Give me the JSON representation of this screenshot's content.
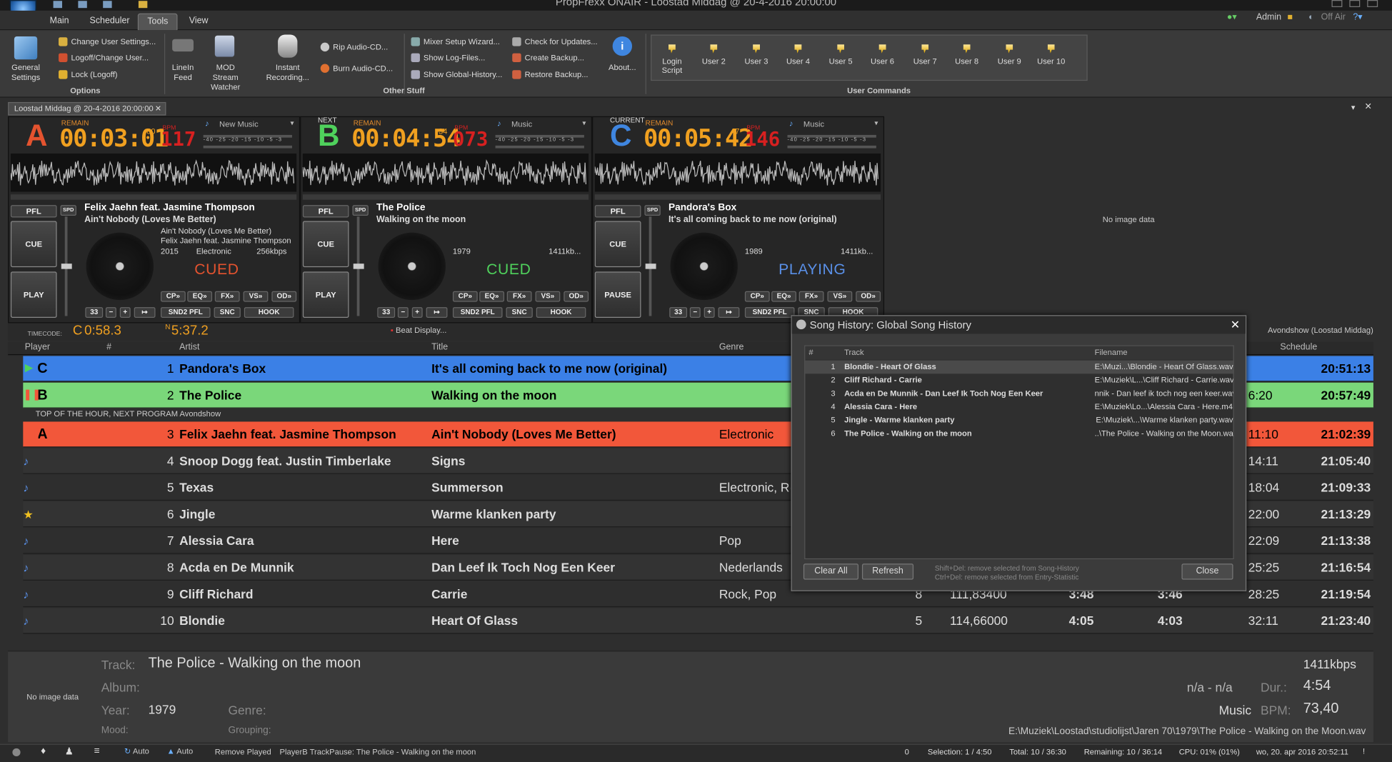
{
  "window": {
    "title": "PropFrexx ONAIR - Loostad Middag @ 20-4-2016 20:00:00"
  },
  "menu": {
    "tabs": [
      "Main",
      "Scheduler",
      "Tools",
      "View"
    ],
    "active": "Tools"
  },
  "top_right": {
    "user": "Admin",
    "onair": "Off Air"
  },
  "ribbon": {
    "general_settings": "General Settings",
    "options": {
      "items": [
        "Change User Settings...",
        "Logoff/Change User...",
        "Lock (Logoff)"
      ],
      "label": "Options"
    },
    "linein": "LineIn Feed",
    "mod_stream": "MOD Stream Watcher",
    "instant_rec": "Instant Recording...",
    "rip": "Rip Audio-CD...",
    "burn": "Burn Audio-CD...",
    "other_stuff": {
      "col1": [
        "Mixer Setup Wizard...",
        "Show Log-Files...",
        "Show Global-History..."
      ],
      "col2": [
        "Check for Updates...",
        "Create Backup...",
        "Restore Backup..."
      ],
      "label": "Other Stuff"
    },
    "about": "About...",
    "user_commands": {
      "items": [
        "Login Script",
        "User 2",
        "User 3",
        "User 4",
        "User 5",
        "User 6",
        "User 7",
        "User 8",
        "User 9",
        "User 10"
      ],
      "label": "User Commands"
    }
  },
  "doc_tab": "Loostad Middag @ 20-4-2016 20:00:00",
  "decks": [
    {
      "letter": "A",
      "tag": "",
      "remain": "REMAIN",
      "time": "00:03:01",
      "time_frac": "80",
      "bpm": "117",
      "bpm_lbl": "BPM",
      "category": "New Music",
      "artist": "Felix Jaehn feat. Jasmine Thompson",
      "title": "Ain't Nobody (Loves Me Better)",
      "info1": "Ain't Nobody (Loves Me Better)",
      "info2": "Felix Jaehn feat. Jasmine Thompson",
      "year": "2015",
      "genre": "Electronic",
      "bitrate": "256kbps",
      "status": "CUED",
      "play": "PLAY",
      "color": "#e4532f",
      "status_color": "#e4532f"
    },
    {
      "letter": "B",
      "tag": "NEXT",
      "remain": "REMAIN",
      "time": "00:04:54",
      "time_frac": "34",
      "bpm": "073",
      "bpm_lbl": "BPM",
      "category": "Music",
      "artist": "The Police",
      "title": "Walking on the moon",
      "info1": "",
      "info2": "",
      "year": "1979",
      "genre": "",
      "bitrate": "1411kb...",
      "status": "CUED",
      "play": "PLAY",
      "color": "#4fd15c",
      "status_color": "#4fd15c"
    },
    {
      "letter": "C",
      "tag": "CURRENT",
      "remain": "REMAIN",
      "time": "00:05:42",
      "time_frac": "47",
      "bpm": "146",
      "bpm_lbl": "BPM",
      "category": "Music",
      "artist": "Pandora's Box",
      "title": "It's all coming back to me now (original)",
      "info1": "",
      "info2": "",
      "year": "1989",
      "genre": "",
      "bitrate": "1411kb...",
      "status": "PLAYING",
      "play": "PAUSE",
      "color": "#3f86e0",
      "status_color": "#5a90e8"
    }
  ],
  "deck_buttons": {
    "pfl": "PFL",
    "spd": "SPD",
    "cue": "CUE",
    "row1": [
      "CP»",
      "EQ»",
      "FX»",
      "VS»",
      "OD»"
    ],
    "row2": [
      "SND2 PFL",
      "SNC",
      "HOOK"
    ],
    "num": "33"
  },
  "no_image": "No image data",
  "timecode": {
    "label": "TIMECODE:",
    "c": "C",
    "c_val": "0:58.3",
    "n": "N",
    "n_val": "5:37.2",
    "beat": "Beat Display..."
  },
  "playlist": {
    "headers": [
      "Player",
      "#",
      "Artist",
      "Title",
      "Genre",
      "Schedule"
    ],
    "program_label": "Avondshow (Loostad Middag)",
    "marker": "TOP OF THE HOUR,  NEXT PROGRAM Avondshow",
    "rows": [
      {
        "player": "C",
        "num": "1",
        "artist": "Pandora's Box",
        "title": "It's all coming back to me now (original)",
        "genre": "",
        "c1": "",
        "c2": "",
        "c3": "",
        "c4": "",
        "c5": "",
        "sched": "20:51:13",
        "bg": "#3b80e6"
      },
      {
        "player": "B",
        "num": "2",
        "artist": "The Police",
        "title": "Walking on the moon",
        "genre": "",
        "c1": "",
        "c2": "",
        "c3": "",
        "c4": "",
        "c5": "6:20",
        "sched": "20:57:49",
        "bg": "#7ad77a"
      },
      {
        "player": "A",
        "num": "3",
        "artist": "Felix Jaehn feat. Jasmine Thompson",
        "title": "Ain't Nobody (Loves Me Better)",
        "genre": "Electronic",
        "c1": "",
        "c2": "",
        "c3": "",
        "c4": "",
        "c5": "11:10",
        "sched": "21:02:39",
        "bg": "#f2573a"
      },
      {
        "player": "",
        "num": "4",
        "artist": "Snoop Dogg feat. Justin Timberlake",
        "title": "Signs",
        "genre": "",
        "c1": "",
        "c2": "",
        "c3": "",
        "c4": "",
        "c5": "14:11",
        "sched": "21:05:40",
        "bg": ""
      },
      {
        "player": "",
        "num": "5",
        "artist": "Texas",
        "title": "Summerson",
        "genre": "Electronic, Roc",
        "c1": "",
        "c2": "",
        "c3": "",
        "c4": "",
        "c5": "18:04",
        "sched": "21:09:33",
        "bg": ""
      },
      {
        "player": "",
        "num": "6",
        "artist": "Jingle",
        "title": "Warme klanken party",
        "genre": "",
        "c1": "",
        "c2": "",
        "c3": "",
        "c4": "",
        "c5": "22:00",
        "sched": "21:13:29",
        "bg": ""
      },
      {
        "player": "",
        "num": "7",
        "artist": "Alessia Cara",
        "title": "Here",
        "genre": "Pop",
        "c1": "",
        "c2": "",
        "c3": "",
        "c4": "",
        "c5": "22:09",
        "sched": "21:13:38",
        "bg": ""
      },
      {
        "player": "",
        "num": "8",
        "artist": "Acda en De Munnik",
        "title": "Dan Leef Ik Toch Nog Een Keer",
        "genre": "Nederlands",
        "c1": "",
        "c2": "",
        "c3": "",
        "c4": "",
        "c5": "25:25",
        "sched": "21:16:54",
        "bg": ""
      },
      {
        "player": "",
        "num": "9",
        "artist": "Cliff Richard",
        "title": "Carrie",
        "genre": "Rock, Pop",
        "c1": "8",
        "c2": "111,83400",
        "c3": "3:48",
        "c4": "3:46",
        "c5": "28:25",
        "sched": "21:19:54",
        "bg": ""
      },
      {
        "player": "",
        "num": "10",
        "artist": "Blondie",
        "title": "Heart Of Glass",
        "genre": "",
        "c1": "5",
        "c2": "114,66000",
        "c3": "4:05",
        "c4": "4:03",
        "c5": "32:11",
        "sched": "21:23:40",
        "bg": ""
      }
    ]
  },
  "dialog": {
    "title": "Song History: Global Song History",
    "headers": [
      "#",
      "Track",
      "Filename"
    ],
    "rows": [
      {
        "num": "1",
        "track": "Blondie - Heart Of Glass",
        "file": "E:\\Muzi...\\Blondie - Heart Of Glass.wav"
      },
      {
        "num": "2",
        "track": "Cliff Richard - Carrie",
        "file": "E:\\Muziek\\L...\\Cliff Richard - Carrie.wav"
      },
      {
        "num": "3",
        "track": "Acda en De Munnik - Dan Leef Ik Toch Nog Een Keer",
        "file": "nnik - Dan leef ik toch nog een keer.wav"
      },
      {
        "num": "4",
        "track": "Alessia Cara - Here",
        "file": "E:\\Muziek\\Lo...\\Alessia Cara - Here.m4a"
      },
      {
        "num": "5",
        "track": "Jingle - Warme klanken party",
        "file": "E:\\Muziek\\...\\Warme klanken party.wav"
      },
      {
        "num": "6",
        "track": "The Police - Walking on the moon",
        "file": "..\\The Police - Walking on the Moon.wav"
      }
    ],
    "clear": "Clear All",
    "refresh": "Refresh",
    "hint1": "Shift+Del: remove selected from Song-History",
    "hint2": "Ctrl+Del: remove selected from Entry-Statistic",
    "close": "Close"
  },
  "bottom": {
    "no_image": "No image data",
    "track_lbl": "Track:",
    "track": "The Police - Walking on the moon",
    "album_lbl": "Album:",
    "year_lbl": "Year:",
    "year": "1979",
    "genre_lbl": "Genre:",
    "mood_lbl": "Mood:",
    "grouping_lbl": "Grouping:",
    "bitrate": "1411kbps",
    "nana": "n/a - n/a",
    "dur_lbl": "Dur.:",
    "dur": "4:54",
    "category": "Music",
    "bpm_lbl": "BPM:",
    "bpm": "73,40",
    "path": "E:\\Muziek\\Loostad\\studiolijst\\Jaren 70\\1979\\The Police - Walking on the Moon.wav"
  },
  "statusbar": {
    "auto1": "Auto",
    "auto2": "Auto",
    "remove_played": "Remove Played",
    "message": "PlayerB TrackPause: The Police - Walking on the moon",
    "zero": "0",
    "selection": "Selection: 1 / 4:50",
    "total": "Total: 10 / 36:30",
    "remaining": "Remaining: 10 / 36:14",
    "cpu": "CPU: 01% (01%)",
    "datetime": "wo, 20. apr 2016 20:52:11"
  }
}
